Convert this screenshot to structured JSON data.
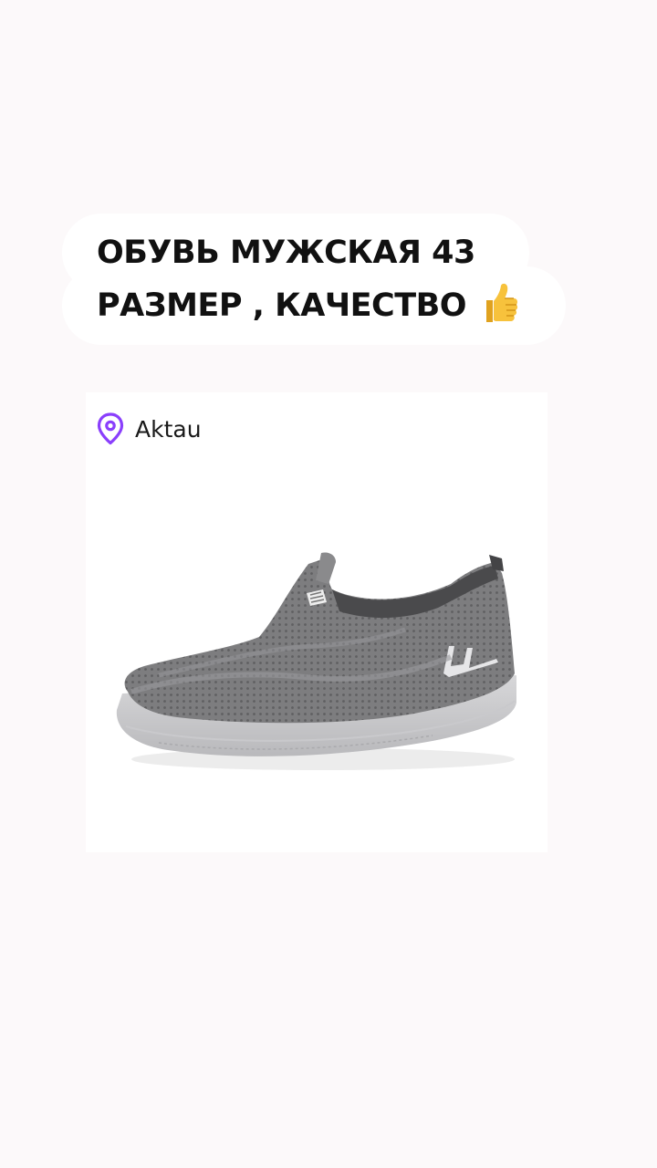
{
  "caption": {
    "line1": "ОБУВЬ МУЖСКАЯ 43",
    "line2": "РАЗМЕР , КАЧЕСТВО",
    "emoji": "thumbs-up-icon"
  },
  "location": {
    "icon": "location-pin-icon",
    "label": "Aktau",
    "icon_color": "#8a3ffc"
  },
  "product": {
    "image": "grey-slip-on-sneaker"
  }
}
